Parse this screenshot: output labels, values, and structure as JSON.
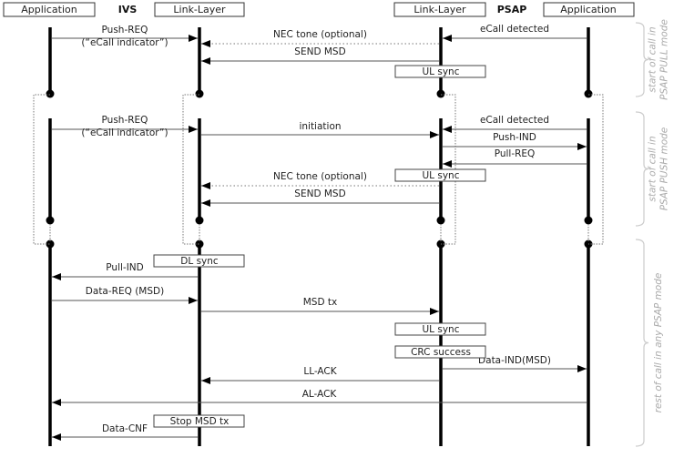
{
  "participants": {
    "ivs_label": "IVS",
    "psap_label": "PSAP",
    "ivs_application": "Application",
    "ivs_link_layer": "Link-Layer",
    "psap_link_layer": "Link-Layer",
    "psap_application": "Application"
  },
  "messages": [
    {
      "label": "Push-REQ",
      "sublabel": "(“eCall indicator”)",
      "from": "ivs_application",
      "to": "ivs_link_layer",
      "style": "solid"
    },
    {
      "label": "NEC tone (optional)",
      "from": "psap_link_layer",
      "to": "ivs_link_layer",
      "style": "dotted"
    },
    {
      "label": "SEND MSD",
      "from": "psap_link_layer",
      "to": "ivs_link_layer",
      "style": "solid"
    },
    {
      "label": "eCall detected",
      "from": "psap_application",
      "to": "psap_link_layer",
      "style": "solid"
    },
    {
      "label": "Push-REQ",
      "sublabel": "(“eCall indicator”)",
      "from": "ivs_application",
      "to": "ivs_link_layer",
      "style": "solid"
    },
    {
      "label": "initiation",
      "from": "ivs_link_layer",
      "to": "psap_link_layer",
      "style": "solid"
    },
    {
      "label": "eCall detected",
      "from": "psap_application",
      "to": "psap_link_layer",
      "style": "solid"
    },
    {
      "label": "Push-IND",
      "from": "psap_link_layer",
      "to": "psap_application",
      "style": "solid"
    },
    {
      "label": "Pull-REQ",
      "from": "psap_application",
      "to": "psap_link_layer",
      "style": "solid"
    },
    {
      "label": "NEC tone (optional)",
      "from": "psap_link_layer",
      "to": "ivs_link_layer",
      "style": "dotted"
    },
    {
      "label": "SEND MSD",
      "from": "psap_link_layer",
      "to": "ivs_link_layer",
      "style": "solid"
    },
    {
      "label": "Pull-IND",
      "from": "ivs_link_layer",
      "to": "ivs_application",
      "style": "solid"
    },
    {
      "label": "Data-REQ (MSD)",
      "from": "ivs_application",
      "to": "ivs_link_layer",
      "style": "solid"
    },
    {
      "label": "MSD tx",
      "from": "ivs_link_layer",
      "to": "psap_link_layer",
      "style": "solid"
    },
    {
      "label": "Data-IND(MSD)",
      "from": "psap_link_layer",
      "to": "psap_application",
      "style": "solid"
    },
    {
      "label": "LL-ACK",
      "from": "psap_link_layer",
      "to": "ivs_link_layer",
      "style": "solid"
    },
    {
      "label": "AL-ACK",
      "from": "psap_application",
      "to": "ivs_application",
      "style": "solid"
    },
    {
      "label": "Data-CNF",
      "from": "ivs_link_layer",
      "to": "ivs_application",
      "style": "solid"
    }
  ],
  "state_boxes": [
    {
      "label": "UL sync",
      "on": "psap_link_layer"
    },
    {
      "label": "UL sync",
      "on": "psap_link_layer"
    },
    {
      "label": "DL sync",
      "on": "ivs_link_layer"
    },
    {
      "label": "UL sync",
      "on": "psap_link_layer"
    },
    {
      "label": "CRC success",
      "on": "psap_link_layer"
    },
    {
      "label": "Stop MSD tx",
      "on": "ivs_link_layer"
    }
  ],
  "phases": [
    {
      "lines": [
        "start of call in",
        "PSAP PULL mode"
      ]
    },
    {
      "lines": [
        "start of call in",
        "PSAP PUSH mode"
      ]
    },
    {
      "lines": [
        "rest of call in any PSAP mode"
      ]
    }
  ],
  "colors": {
    "line": "#000000",
    "arrow": "#555555",
    "brace": "#cccccc",
    "phase_text": "#aaaaaa"
  }
}
